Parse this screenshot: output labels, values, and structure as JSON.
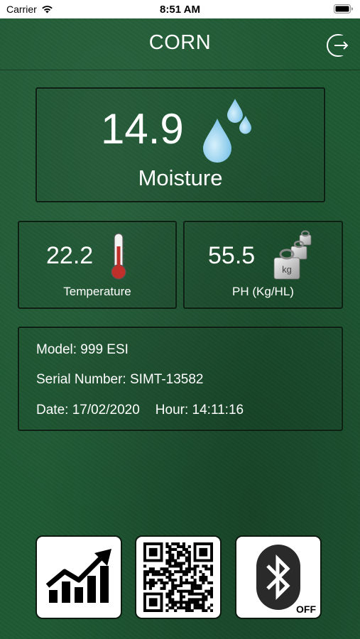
{
  "status_bar": {
    "carrier": "Carrier",
    "time": "8:51 AM"
  },
  "header": {
    "title": "CORN"
  },
  "moisture": {
    "value": "14.9",
    "label": "Moisture"
  },
  "temperature": {
    "value": "22.2",
    "label": "Temperature"
  },
  "ph": {
    "value": "55.5",
    "label": "PH (Kg/HL)",
    "weight_unit": "kg"
  },
  "info": {
    "model": "Model: 999 ESI",
    "serial": "Serial Number: SIMT-13582",
    "date": "Date: 17/02/2020",
    "hour": "Hour:  14:11:16"
  },
  "buttons": {
    "bluetooth_state": "OFF"
  },
  "icons": [
    "wifi-icon",
    "battery-icon",
    "logout-icon",
    "water-drops-icon",
    "thermometer-icon",
    "weights-icon",
    "growth-chart-icon",
    "qr-code-icon",
    "bluetooth-icon"
  ],
  "colors": {
    "background": "#1f5a34",
    "panel_border": "#0c1f12",
    "drop": "#8ecff0",
    "thermometer_red": "#c0302a"
  }
}
